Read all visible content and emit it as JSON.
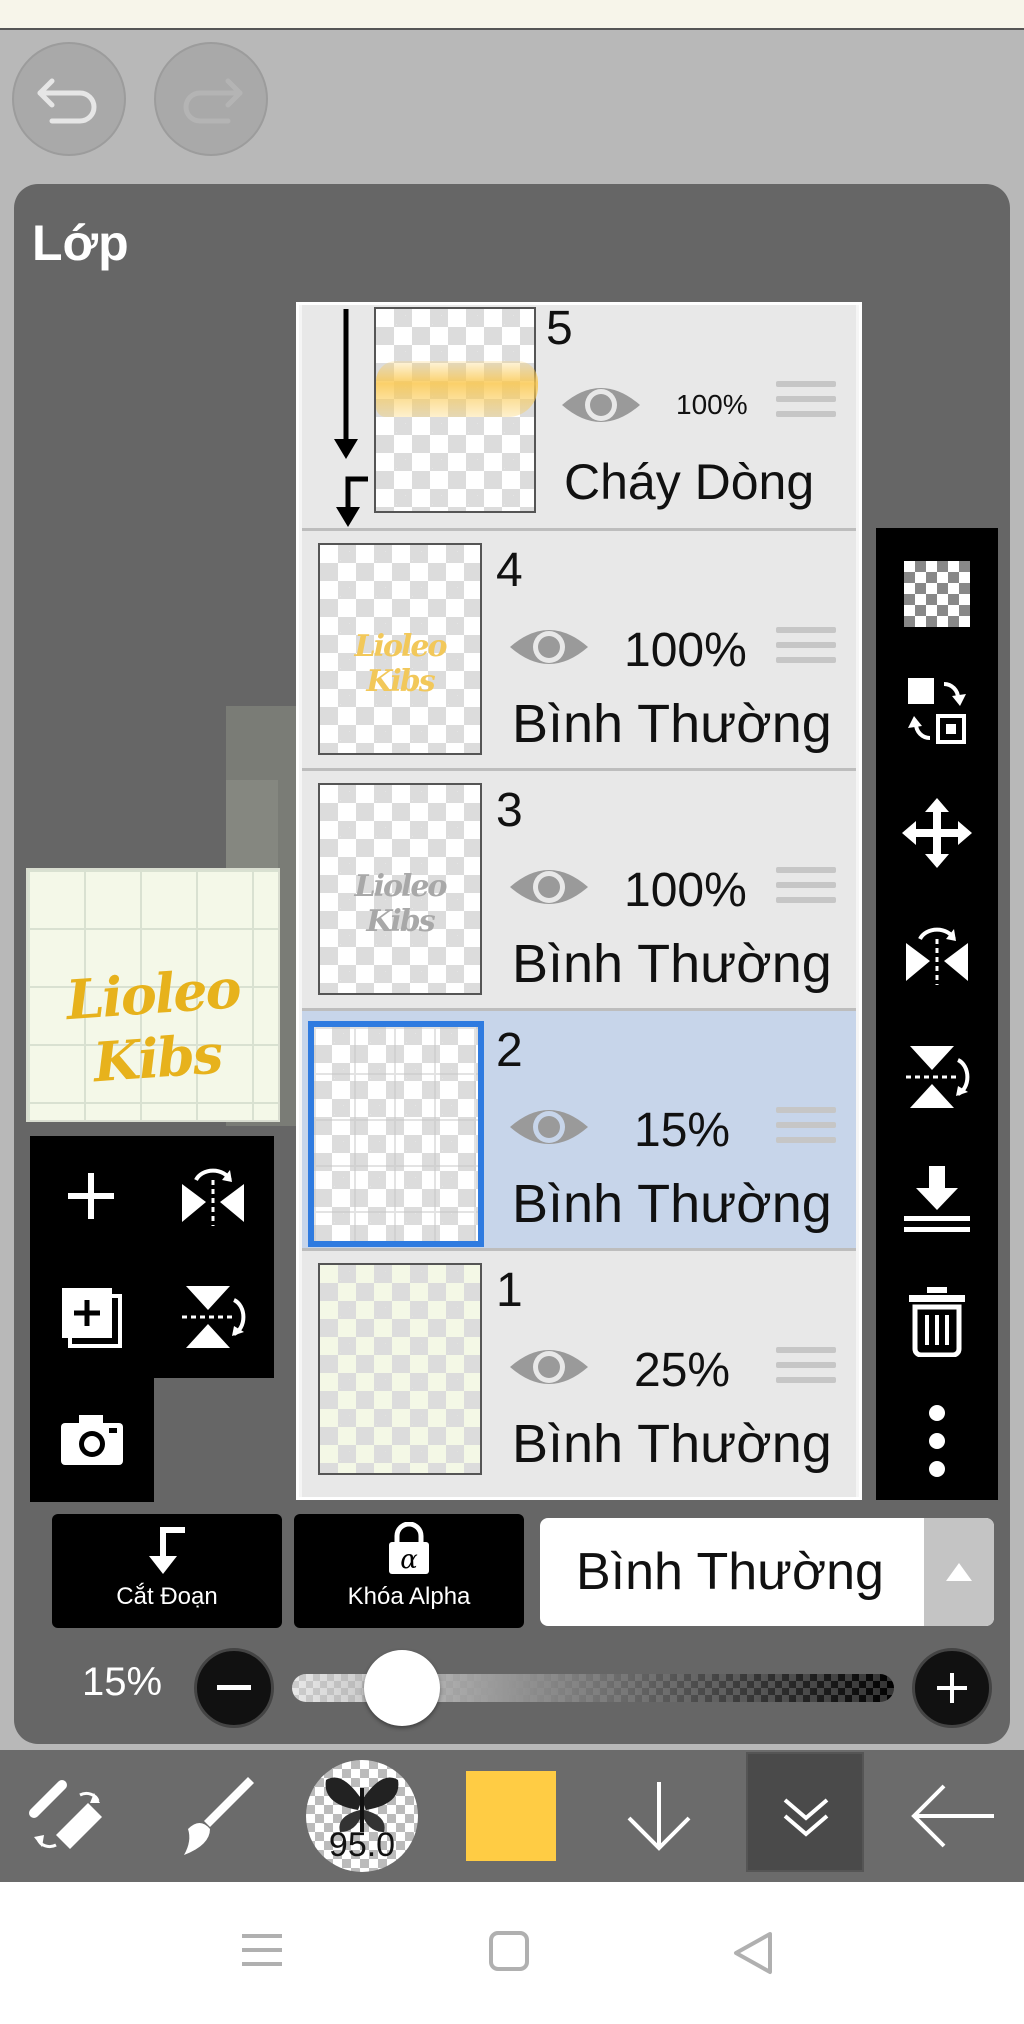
{
  "panel": {
    "title": "Lớp"
  },
  "preview": {
    "text": "Lioleo Kibs"
  },
  "layers": [
    {
      "number": "5",
      "opacity": "100%",
      "mode": "Cháy Dòng",
      "clipped": true,
      "selected": false
    },
    {
      "number": "4",
      "opacity": "100%",
      "mode": "Bình Thường",
      "thumb_text": "Lioleo Kibs",
      "selected": false
    },
    {
      "number": "3",
      "opacity": "100%",
      "mode": "Bình Thường",
      "thumb_text": "Lioleo Kibs",
      "selected": false
    },
    {
      "number": "2",
      "opacity": "15%",
      "mode": "Bình Thường",
      "selected": true
    },
    {
      "number": "1",
      "opacity": "25%",
      "mode": "Bình Thường",
      "selected": false
    }
  ],
  "left_tools": [
    "add-layer-icon",
    "flip-horizontal-icon",
    "add-layer-copy-icon",
    "flip-vertical-icon",
    "camera-icon"
  ],
  "right_tools": [
    "transparent-checker-icon",
    "swap-layers-icon",
    "move-icon",
    "flip-horizontal-icon",
    "flip-vertical-icon",
    "merge-down-icon",
    "trash-icon",
    "more-vertical-icon"
  ],
  "controls": {
    "clip_label": "Cắt Đoạn",
    "alpha_lock_label": "Khóa Alpha",
    "blend_mode": "Bình Thường",
    "opacity_label": "15%",
    "opacity_value": 0.15
  },
  "toolbar": {
    "brush_size": "95.0",
    "color": "#FFCC44",
    "items": [
      "transform-eraser-icon",
      "brush-icon",
      "brush-size-icon",
      "color-swatch",
      "arrow-down-icon",
      "chevron-double-down-icon",
      "arrow-left-icon"
    ]
  },
  "colors": {
    "panel": "#666666",
    "accent_selected": "#2f7be0",
    "selected_bg": "#c7d5ea",
    "brand_yellow": "#e7b21c"
  }
}
